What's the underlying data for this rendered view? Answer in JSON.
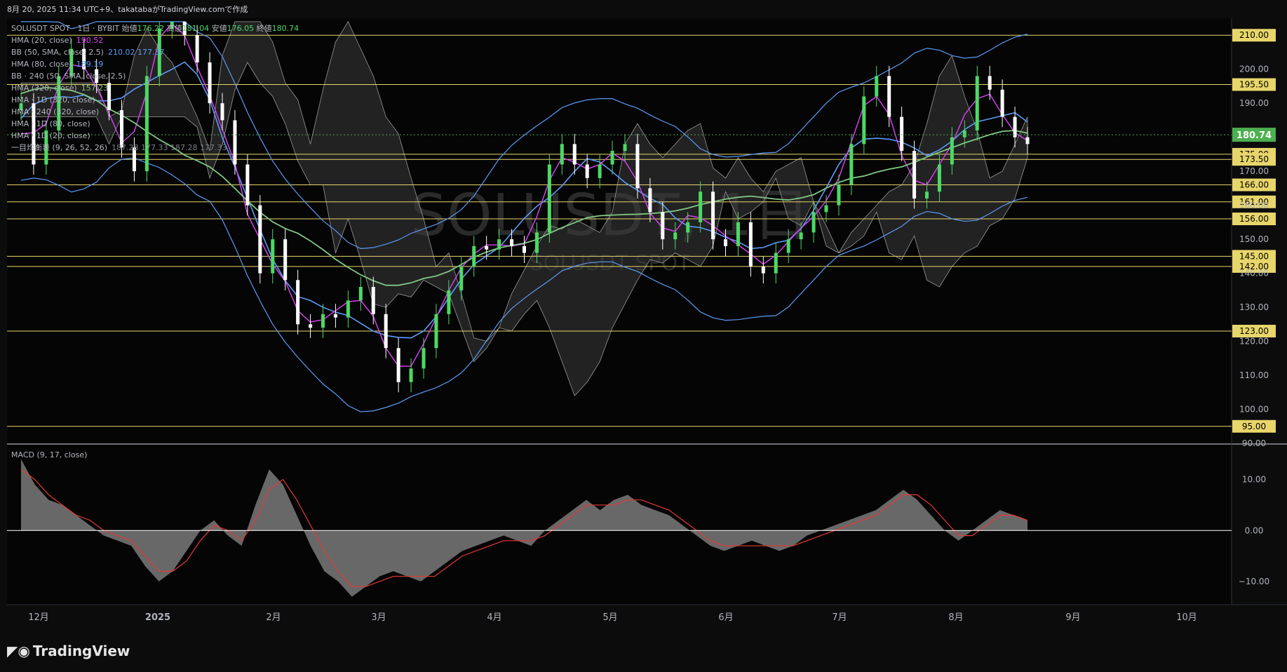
{
  "header": {
    "created": "8月 20, 2025 11:34 UTC+9、takatabaがTradingView.comで作成"
  },
  "symbol": {
    "name": "SOLUSDT SPOT",
    "timeframe": "1日",
    "exchange": "BYBIT",
    "open_label": "始値",
    "open": "176.22",
    "high_label": "高値",
    "high": "181.04",
    "low_label": "安値",
    "low": "176.05",
    "close_label": "終値",
    "close": "180.74"
  },
  "watermark": {
    "main": "SOLUSDT, 1日",
    "sub": "SOLUSDT SPOT"
  },
  "indicators": [
    {
      "label": "HMA (20, close)",
      "value": "190.52",
      "color": "#e040fb"
    },
    {
      "label": "BB (50, SMA, close, 2.5)",
      "value": "210.02  177.37",
      "color": "#5b9cf6"
    },
    {
      "label": "HMA (80, close)",
      "value": "189.19",
      "color": "#5b9cf6"
    },
    {
      "label": "BB · 240 (50, SMA, close, 2.5)",
      "value": "",
      "color": "#b2b5be"
    },
    {
      "label": "HMA (320, close)",
      "value": "157.23",
      "color": "#81c784"
    },
    {
      "label": "HMA · 1D (320, close)",
      "value": "",
      "color": "#b2b5be"
    },
    {
      "label": "HMA · 240 (320, close)",
      "value": "",
      "color": "#b2b5be"
    },
    {
      "label": "HMA · 1D (80, close)",
      "value": "",
      "color": "#b2b5be"
    },
    {
      "label": "HMA · 1D (20, close)",
      "value": "",
      "color": "#b2b5be"
    },
    {
      "label": "一目均衡表 (9, 26, 52, 26)",
      "value": "187.28  177.33  187.28  177.33",
      "color": "#787b86"
    }
  ],
  "macd_label": "MACD (9, 17, close)",
  "brand": {
    "name": "TradingView"
  },
  "colors": {
    "up": "#4cd964",
    "down": "#ffffff",
    "level": "#e8d66b",
    "price_tag": "#4caf50"
  },
  "chart_data": {
    "type": "candlestick",
    "price_axis": {
      "ylim": [
        90,
        215
      ],
      "ticks": [
        90,
        100,
        110,
        120,
        130,
        140,
        150,
        160,
        170,
        180,
        190,
        200
      ]
    },
    "time_axis": {
      "labels": [
        "12月",
        "2025",
        "2月",
        "3月",
        "4月",
        "5月",
        "6月",
        "7月",
        "8月",
        "9月",
        "10月"
      ]
    },
    "horizontal_levels": [
      210.0,
      195.5,
      175.0,
      173.5,
      166.0,
      161.0,
      156.0,
      145.0,
      142.0,
      123.0,
      95.0
    ],
    "level_labels": [
      "210.00",
      "195.50",
      "175.00",
      "173.50",
      "166.00",
      "161.00",
      "156.00",
      "145.00",
      "142.00",
      "123.00",
      "95.00"
    ],
    "price_tick_labels": [
      "90.00",
      "100.00",
      "110.00",
      "120.00",
      "130.00",
      "140.00",
      "150.00",
      "160.00",
      "170.00",
      "180.00",
      "190.00",
      "200.00"
    ],
    "last_price": 180.74,
    "last_price_label": "180.74",
    "close_series": [
      190,
      172,
      182,
      198,
      206,
      200,
      196,
      188,
      177,
      170,
      198,
      212,
      218,
      210,
      202,
      190,
      185,
      172,
      160,
      140,
      150,
      138,
      125,
      124,
      128,
      127,
      132,
      136,
      128,
      118,
      108,
      112,
      118,
      128,
      135,
      142,
      148,
      147,
      150,
      148,
      146,
      152,
      172,
      178,
      172,
      168,
      172,
      176,
      178,
      165,
      158,
      150,
      152,
      155,
      164,
      150,
      148,
      155,
      142,
      140,
      146,
      150,
      152,
      158,
      160,
      166,
      178,
      192,
      198,
      186,
      176,
      162,
      164,
      172,
      180,
      182,
      198,
      194,
      186,
      180,
      178
    ],
    "macd": {
      "axis_ticks": [
        10,
        0,
        -10
      ],
      "axis_labels": [
        "10.00",
        "0.00",
        "−10.00"
      ],
      "hist": [
        14,
        9,
        6,
        5,
        3,
        1,
        -1,
        -2,
        -3,
        -7,
        -10,
        -8,
        -4,
        0,
        2,
        -1,
        -3,
        5,
        12,
        9,
        3,
        -3,
        -8,
        -10,
        -13,
        -11,
        -9,
        -8,
        -9,
        -10,
        -8,
        -6,
        -4,
        -3,
        -2,
        -1,
        -2,
        -3,
        0,
        2,
        4,
        6,
        4,
        6,
        7,
        5,
        4,
        3,
        1,
        -1,
        -3,
        -4,
        -3,
        -2,
        -3,
        -4,
        -3,
        -1,
        0,
        1,
        2,
        3,
        4,
        6,
        8,
        6,
        3,
        0,
        -2,
        0,
        2,
        4,
        3,
        2
      ],
      "signal": [
        12,
        10,
        7,
        5,
        3,
        2,
        0,
        -1,
        -2,
        -5,
        -8,
        -8,
        -6,
        -2,
        1,
        0,
        -2,
        2,
        8,
        10,
        6,
        1,
        -4,
        -8,
        -11,
        -11,
        -10,
        -9,
        -9,
        -9,
        -9,
        -7,
        -5,
        -4,
        -3,
        -2,
        -2,
        -2,
        -1,
        1,
        3,
        5,
        5,
        5,
        6,
        6,
        5,
        4,
        2,
        0,
        -2,
        -3,
        -3,
        -3,
        -3,
        -3,
        -3,
        -2,
        -1,
        0,
        1,
        2,
        3,
        5,
        7,
        7,
        5,
        2,
        -1,
        -1,
        1,
        3,
        3,
        2
      ]
    }
  }
}
